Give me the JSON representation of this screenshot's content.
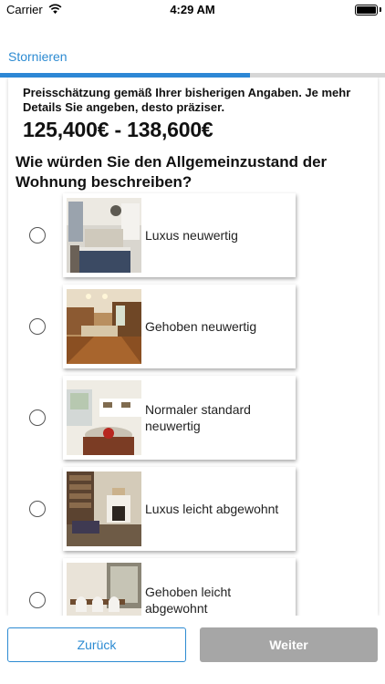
{
  "status_bar": {
    "carrier": "Carrier",
    "time": "4:29 AM",
    "wifi_icon": "wifi-icon",
    "battery_icon": "battery-icon"
  },
  "nav": {
    "cancel_label": "Stornieren"
  },
  "progress": {
    "fraction": 0.65,
    "fill_color": "#2d87d5",
    "track_color": "#d6d6d6"
  },
  "estimate": {
    "text": "Preisschätzung gemäß Ihrer bisherigen Angaben. Je mehr Details Sie angeben, desto präziser.",
    "price_range": "125,400€ - 138,600€"
  },
  "question": "Wie würden Sie den Allgemeinzustand der Wohnung beschreiben?",
  "options": [
    {
      "label": "Luxus neuwertig",
      "selected": false
    },
    {
      "label": "Gehoben neuwertig",
      "selected": false
    },
    {
      "label": "Normaler standard neuwertig",
      "selected": false
    },
    {
      "label": "Luxus leicht abgewohnt",
      "selected": false
    },
    {
      "label": "Gehoben leicht abgewohnt",
      "selected": false
    }
  ],
  "footer": {
    "back_label": "Zurück",
    "next_label": "Weiter"
  },
  "colors": {
    "accent": "#2d8bd2",
    "disabled_button": "#a6a6a6"
  }
}
